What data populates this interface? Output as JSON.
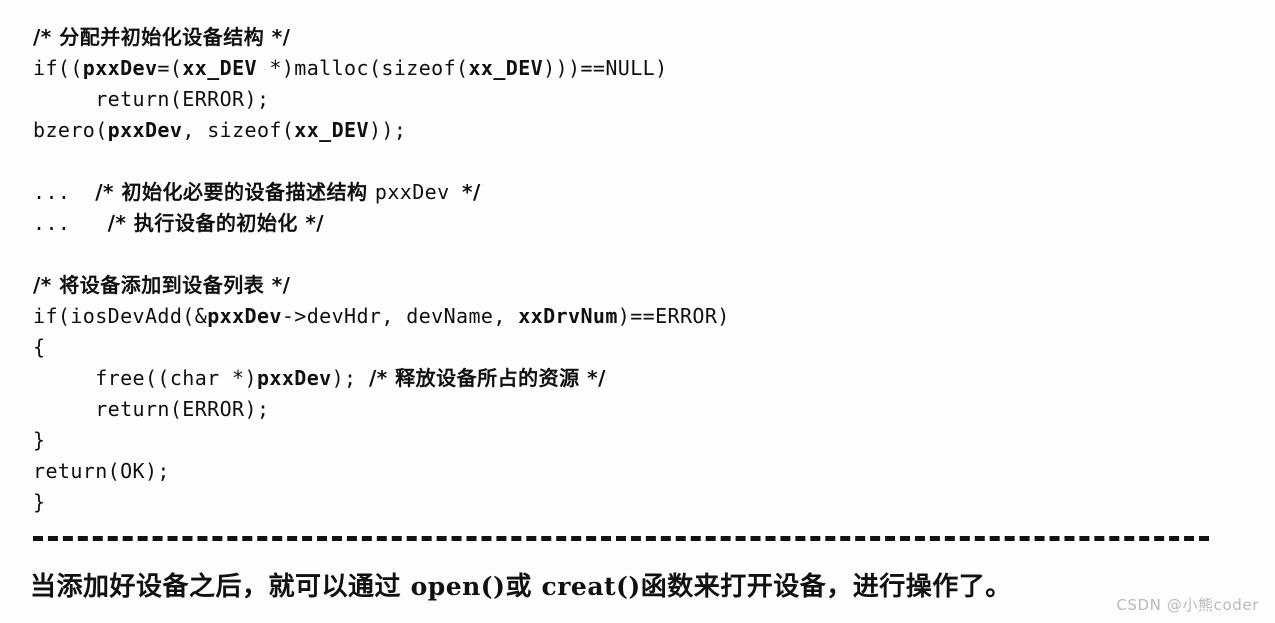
{
  "page": {
    "kind": "scanned-book-page",
    "background_color": "#fdfdfd",
    "text_color": "#101010"
  },
  "code": {
    "language": "c",
    "lines": [
      {
        "id": "line-1",
        "indent": 0,
        "segments": [
          {
            "type": "cjk",
            "text": "/* 分配并初始化设备结构 */"
          }
        ]
      },
      {
        "id": "line-2",
        "indent": 0,
        "segments": [
          {
            "type": "mono",
            "text": "if(("
          },
          {
            "type": "mono-bold",
            "text": "pxxDev"
          },
          {
            "type": "mono",
            "text": "=("
          },
          {
            "type": "mono-bold",
            "text": "xx_DEV"
          },
          {
            "type": "mono",
            "text": " *)malloc(sizeof("
          },
          {
            "type": "mono-bold",
            "text": "xx_DEV"
          },
          {
            "type": "mono",
            "text": ")))==NULL)"
          }
        ]
      },
      {
        "id": "line-3",
        "indent": 0,
        "segments": [
          {
            "type": "mono",
            "text": "     return(ERROR);"
          }
        ]
      },
      {
        "id": "line-4",
        "indent": 0,
        "segments": [
          {
            "type": "mono",
            "text": "bzero("
          },
          {
            "type": "mono-bold",
            "text": "pxxDev"
          },
          {
            "type": "mono",
            "text": ", sizeof("
          },
          {
            "type": "mono-bold",
            "text": "xx_DEV"
          },
          {
            "type": "mono",
            "text": "));"
          }
        ]
      },
      {
        "id": "line-5",
        "indent": 0,
        "blank": true,
        "segments": []
      },
      {
        "id": "line-6",
        "indent": 0,
        "segments": [
          {
            "type": "mono",
            "text": "...  "
          },
          {
            "type": "cjk",
            "text": "/* 初始化必要的设备描述结构 "
          },
          {
            "type": "mono",
            "text": "pxxDev "
          },
          {
            "type": "cjk",
            "text": "*/"
          }
        ]
      },
      {
        "id": "line-7",
        "indent": 0,
        "segments": [
          {
            "type": "mono",
            "text": "...   "
          },
          {
            "type": "cjk",
            "text": "/* 执行设备的初始化 */"
          }
        ]
      },
      {
        "id": "line-8",
        "indent": 0,
        "blank": true,
        "segments": []
      },
      {
        "id": "line-9",
        "indent": 0,
        "segments": [
          {
            "type": "cjk",
            "text": "/* 将设备添加到设备列表 */"
          }
        ]
      },
      {
        "id": "line-10",
        "indent": 0,
        "segments": [
          {
            "type": "mono",
            "text": "if(iosDevAdd(&"
          },
          {
            "type": "mono-bold",
            "text": "pxxDev"
          },
          {
            "type": "mono",
            "text": "->devHdr, devName, "
          },
          {
            "type": "mono-bold",
            "text": "xxDrvNum"
          },
          {
            "type": "mono",
            "text": ")==ERROR)"
          }
        ]
      },
      {
        "id": "line-11",
        "indent": 0,
        "segments": [
          {
            "type": "mono",
            "text": "{"
          }
        ]
      },
      {
        "id": "line-12",
        "indent": 0,
        "segments": [
          {
            "type": "mono",
            "text": "     free((char *)"
          },
          {
            "type": "mono-bold",
            "text": "pxxDev"
          },
          {
            "type": "mono",
            "text": "); "
          },
          {
            "type": "cjk",
            "text": "/* 释放设备所占的资源 */"
          }
        ]
      },
      {
        "id": "line-13",
        "indent": 0,
        "segments": [
          {
            "type": "mono",
            "text": "     return(ERROR);"
          }
        ]
      },
      {
        "id": "line-14",
        "indent": 0,
        "segments": [
          {
            "type": "mono",
            "text": "}"
          }
        ]
      },
      {
        "id": "line-15",
        "indent": 0,
        "segments": [
          {
            "type": "mono",
            "text": "return(OK);"
          }
        ]
      },
      {
        "id": "line-16",
        "indent": 0,
        "segments": [
          {
            "type": "mono",
            "text": "}"
          }
        ]
      }
    ]
  },
  "separator": {
    "style": "dashed",
    "color": "#121212"
  },
  "prose": {
    "parts": [
      {
        "type": "cjk",
        "text": "当添加好设备之后，就可以通过 "
      },
      {
        "type": "fn",
        "text": "open()"
      },
      {
        "type": "cjk",
        "text": "或 "
      },
      {
        "type": "fn",
        "text": "creat()"
      },
      {
        "type": "cjk",
        "text": "函数来打开设备，进行操作了。"
      }
    ]
  },
  "watermark": {
    "text": "CSDN @小熊coder",
    "color": "#b9b9b9"
  }
}
